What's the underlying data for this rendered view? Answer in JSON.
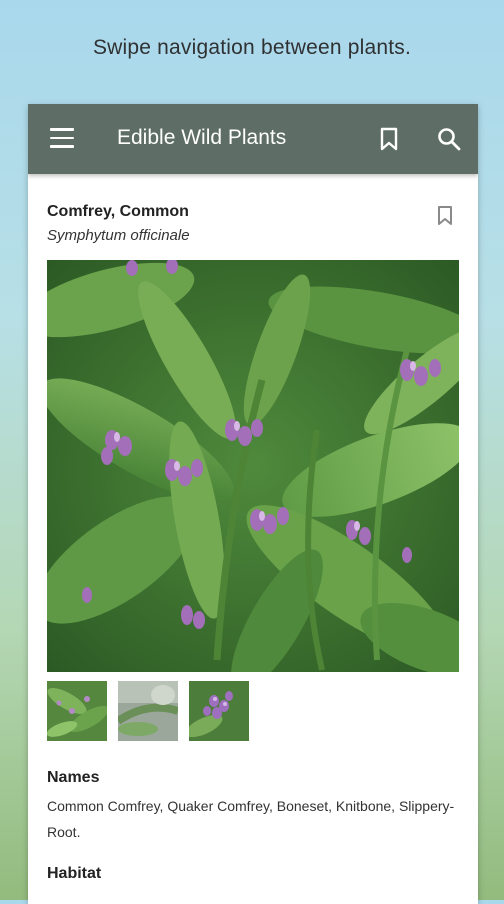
{
  "caption": "Swipe navigation between plants.",
  "appbar": {
    "title": "Edible Wild Plants",
    "menu_icon": "menu-icon",
    "bookmark_icon": "bookmark-icon",
    "search_icon": "search-icon"
  },
  "plant": {
    "common_name": "Comfrey, Common",
    "scientific_name": "Symphytum officinale",
    "bookmark_icon": "bookmark-outline-icon"
  },
  "sections": {
    "names_title": "Names",
    "names_body": "Common Comfrey, Quaker Comfrey, Boneset, Knitbone, Slippery-Root.",
    "next_title": "Habitat"
  },
  "colors": {
    "appbar": "#5e6e66",
    "background_top": "#a9d8ec",
    "background_bottom": "#93bb7d"
  }
}
